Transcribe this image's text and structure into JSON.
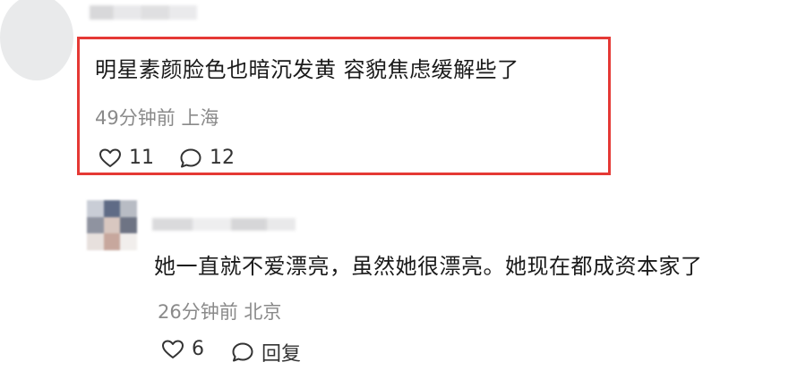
{
  "comment1": {
    "text": "明星素颜脸色也暗沉发黄 容貌焦虑缓解些了",
    "meta": "49分钟前 上海",
    "like_count": "11",
    "comment_count": "12",
    "highlight_color": "#e53935"
  },
  "comment2": {
    "text": "她一直就不爱漂亮，虽然她很漂亮。她现在都成资本家了",
    "meta": "26分钟前 北京",
    "like_count": "6",
    "reply_label": "回复"
  },
  "icons": {
    "like": "heart-icon",
    "comment": "comment-bubble-icon"
  }
}
